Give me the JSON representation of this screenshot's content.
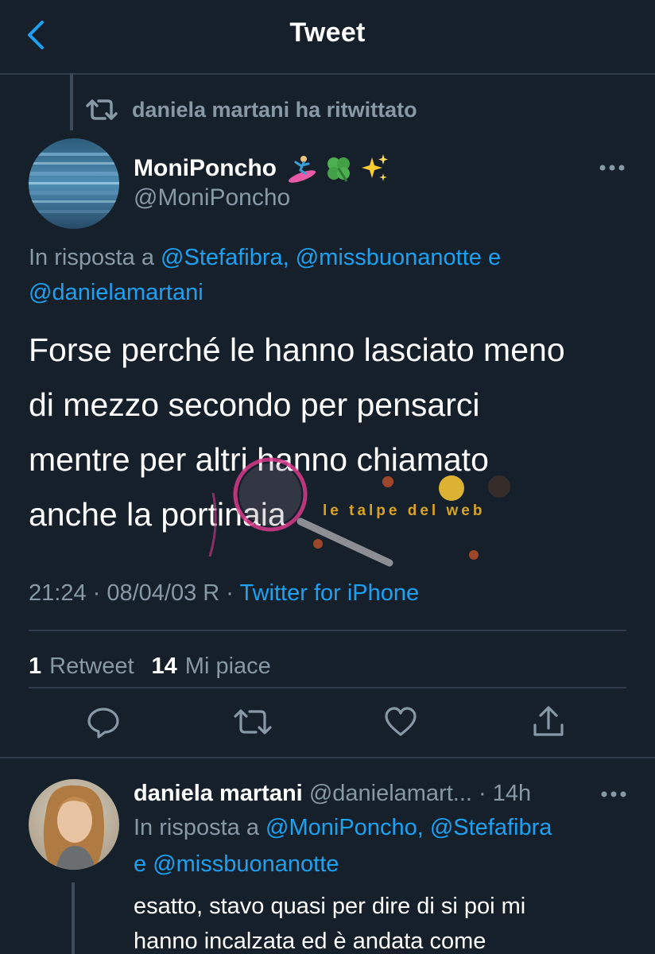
{
  "header": {
    "title": "Tweet",
    "back_icon": "chevron-left-icon",
    "accent_color": "#1da1f2"
  },
  "retweet_context": {
    "icon": "retweet-icon",
    "text": "daniela martani ha ritwittato"
  },
  "tweet": {
    "author_name": "MoniPoncho",
    "author_emojis": [
      "surfer-emoji",
      "four-leaf-clover-emoji",
      "sparkles-emoji"
    ],
    "author_handle": "@MoniPoncho",
    "reply_prefix": "In risposta a",
    "mentions": [
      "@Stefafibra,",
      "@missbuonanotte",
      "@danielamartani"
    ],
    "reply_joiner": "e",
    "text_lines": [
      "Forse perché le hanno lasciato meno",
      "di mezzo secondo per pensarci",
      "mentre per altri hanno chiamato",
      "anche la portinaia"
    ],
    "timestamp": "21:24 · 08/04/03 R ·",
    "source": "Twitter for iPhone",
    "retweet_count": "1",
    "retweet_label": "Retweet",
    "like_count": "14",
    "like_label": "Mi piace"
  },
  "actions": {
    "reply": "reply-icon",
    "retweet": "retweet-icon",
    "like": "heart-icon",
    "share": "share-icon"
  },
  "watermark": {
    "label": "le talpe del web"
  },
  "reply": {
    "author_name": "daniela martani",
    "author_handle": "@danielamart... · 14h",
    "reply_prefix": "In risposta a",
    "mentions": [
      "@MoniPoncho,",
      "@Stefafibra",
      "@missbuonanotte"
    ],
    "reply_joiner": "e",
    "text_lines": [
      "esatto, stavo quasi per dire di si poi mi",
      "hanno incalzata ed è andata come"
    ]
  }
}
